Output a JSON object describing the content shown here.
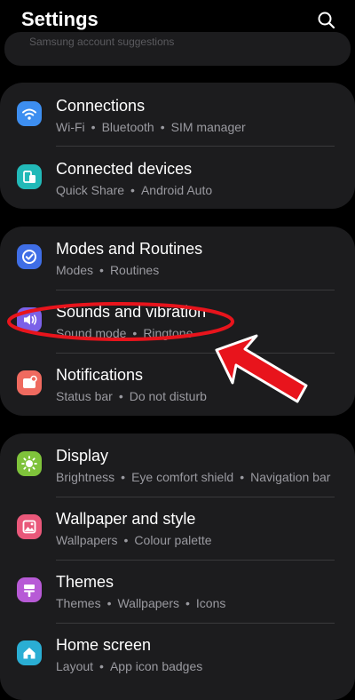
{
  "header": {
    "title": "Settings",
    "search_icon": "search-icon"
  },
  "partial_peek": "Samsung account suggestions",
  "groups": [
    {
      "items": [
        {
          "title": "Connections",
          "subs": [
            "Wi-Fi",
            "Bluetooth",
            "SIM manager"
          ],
          "icon": "wifi-icon",
          "color": "#3d8ef0"
        },
        {
          "title": "Connected devices",
          "subs": [
            "Quick Share",
            "Android Auto"
          ],
          "icon": "connected-devices-icon",
          "color": "#22b9b8"
        }
      ]
    },
    {
      "items": [
        {
          "title": "Modes and Routines",
          "subs": [
            "Modes",
            "Routines"
          ],
          "icon": "check-circle-icon",
          "color": "#3f6ee6"
        },
        {
          "title": "Sounds and vibration",
          "subs": [
            "Sound mode",
            "Ringtone"
          ],
          "icon": "speaker-icon",
          "color": "#7b61e8"
        },
        {
          "title": "Notifications",
          "subs": [
            "Status bar",
            "Do not disturb"
          ],
          "icon": "notification-icon",
          "color": "#ef6a5f"
        }
      ]
    },
    {
      "items": [
        {
          "title": "Display",
          "subs": [
            "Brightness",
            "Eye comfort shield",
            "Navigation bar"
          ],
          "icon": "sun-icon",
          "color": "#7fc33b"
        },
        {
          "title": "Wallpaper and style",
          "subs": [
            "Wallpapers",
            "Colour palette"
          ],
          "icon": "image-icon",
          "color": "#e9587a"
        },
        {
          "title": "Themes",
          "subs": [
            "Themes",
            "Wallpapers",
            "Icons"
          ],
          "icon": "themes-icon",
          "color": "#b75ad6"
        },
        {
          "title": "Home screen",
          "subs": [
            "Layout",
            "App icon badges"
          ],
          "icon": "home-icon",
          "color": "#2aaed4"
        }
      ]
    }
  ],
  "annotation": {
    "highlight_color": "#e8141c",
    "target": "Sounds and vibration"
  }
}
